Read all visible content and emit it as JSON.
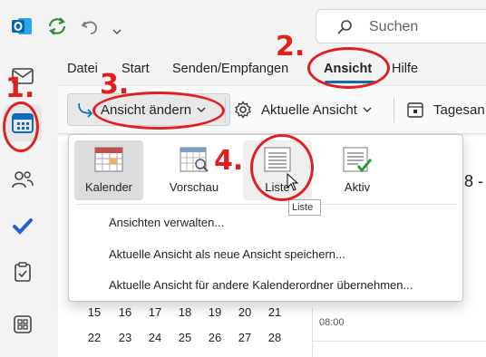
{
  "titlebar": {
    "search_placeholder": "Suchen"
  },
  "menu_tabs": [
    "Datei",
    "Start",
    "Senden/Empfangen",
    "Ansicht",
    "Hilfe"
  ],
  "ribbon": {
    "change_view_label": "Ansicht ändern",
    "current_view_label": "Aktuelle Ansicht",
    "day_view_label_truncated": "Tagesan"
  },
  "dropdown": {
    "views": [
      "Kalender",
      "Vorschau",
      "Liste",
      "Aktiv"
    ],
    "menu_items": [
      "Ansichten verwalten...",
      "Aktuelle Ansicht als neue Ansicht speichern...",
      "Aktuelle Ansicht für andere Kalenderordner übernehmen..."
    ]
  },
  "tooltip": "Liste",
  "calendar": {
    "row1": [
      "15",
      "16",
      "17",
      "18",
      "19",
      "20",
      "21"
    ],
    "row2": [
      "22",
      "23",
      "24",
      "25",
      "26",
      "27",
      "28"
    ],
    "time_label": "08:00",
    "date_fragment": "8 -"
  },
  "annotations": [
    "1.",
    "2.",
    "3.",
    "4."
  ],
  "colors": {
    "accent": "#0f6cbd",
    "annotation_red": "#e02020"
  }
}
